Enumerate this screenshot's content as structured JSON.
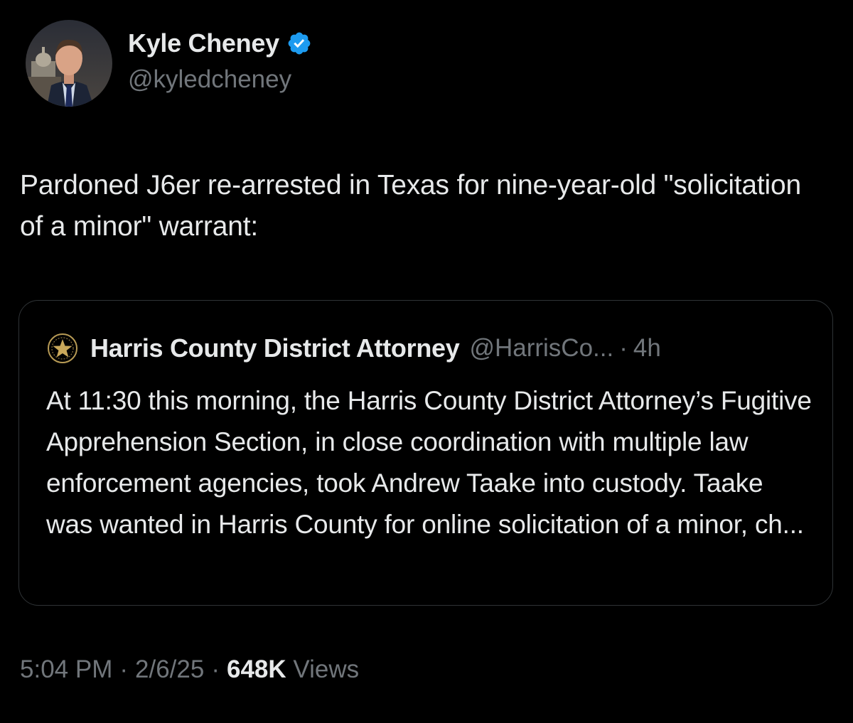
{
  "author": {
    "display_name": "Kyle Cheney",
    "handle": "@kyledcheney",
    "verified": true,
    "avatar_icon": "profile-photo"
  },
  "tweet": {
    "text": "Pardoned J6er re-arrested in Texas for nine-year-old \"solicitation of a minor\" warrant:"
  },
  "quote": {
    "avatar_icon": "county-seal-star-icon",
    "name": "Harris County District Attorney",
    "handle": "@HarrisCo...",
    "separator": "·",
    "time": "4h",
    "text": "At 11:30 this morning, the Harris County District Attorney’s Fugitive Apprehension Section, in close coordination with multiple law enforcement agencies, took Andrew Taake into custody. Taake was wanted in Harris County for online solicitation of a minor, ch..."
  },
  "meta": {
    "time": "5:04 PM",
    "separator": "·",
    "date": "2/6/25",
    "views_count": "648K",
    "views_label": "Views"
  },
  "colors": {
    "background": "#000000",
    "primary_text": "#e7e9ea",
    "secondary_text": "#71767b",
    "verified_badge": "#1d9bf0",
    "card_border": "#2f3336"
  }
}
